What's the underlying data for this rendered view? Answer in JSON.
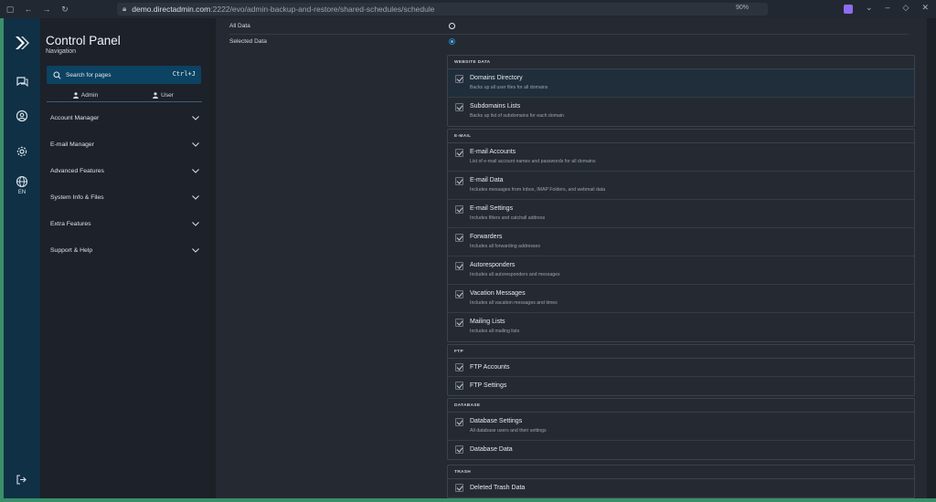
{
  "browser": {
    "url_host": "demo.directadmin.com",
    "url_path": ":2222/evo/admin-backup-and-restore/shared-schedules/schedule",
    "zoom": "90%"
  },
  "rail": {
    "language": "EN"
  },
  "sidebar": {
    "title": "Control Panel",
    "subtitle": "Navigation",
    "search_placeholder": "Search for pages",
    "search_shortcut": "Ctrl+J",
    "roles": [
      "Admin",
      "User"
    ],
    "menu": [
      "Account Manager",
      "E-mail Manager",
      "Advanced Features",
      "System Info & Files",
      "Extra Features",
      "Support & Help"
    ]
  },
  "main": {
    "options": [
      {
        "label": "All Data",
        "selected": false
      },
      {
        "label": "Selected Data",
        "selected": true
      }
    ],
    "groups": [
      {
        "header": "WEBSITE DATA",
        "items": [
          {
            "name": "Domains Directory",
            "desc": "Backs up all user files for all domains",
            "checked": true
          },
          {
            "name": "Subdomains Lists",
            "desc": "Backs up list of subdomains for each domain",
            "checked": true
          }
        ]
      },
      {
        "header": "E-MAIL",
        "items": [
          {
            "name": "E-mail Accounts",
            "desc": "List of e-mail account names and passwords for all domains",
            "checked": true
          },
          {
            "name": "E-mail Data",
            "desc": "Includes messages from Inbox, IMAP Folders, and webmail data",
            "checked": true
          },
          {
            "name": "E-mail Settings",
            "desc": "Includes filters and catchall address",
            "checked": true
          },
          {
            "name": "Forwarders",
            "desc": "Includes all forwarding addresses",
            "checked": true
          },
          {
            "name": "Autoresponders",
            "desc": "Includes all autoresponders and messages",
            "checked": true
          },
          {
            "name": "Vacation Messages",
            "desc": "Includes all vacation messages and times",
            "checked": true
          },
          {
            "name": "Mailing Lists",
            "desc": "Includes all mailing lists",
            "checked": true
          }
        ]
      },
      {
        "header": "FTP",
        "items": [
          {
            "name": "FTP Accounts",
            "desc": "",
            "checked": true
          },
          {
            "name": "FTP Settings",
            "desc": "",
            "checked": true
          }
        ]
      },
      {
        "header": "DATABASE",
        "items": [
          {
            "name": "Database Settings",
            "desc": "All database users and their settings",
            "checked": true
          },
          {
            "name": "Database Data",
            "desc": "",
            "checked": true
          }
        ]
      },
      {
        "header": "TRASH",
        "items": [
          {
            "name": "Deleted Trash Data",
            "desc": "",
            "checked": true
          }
        ]
      }
    ]
  }
}
